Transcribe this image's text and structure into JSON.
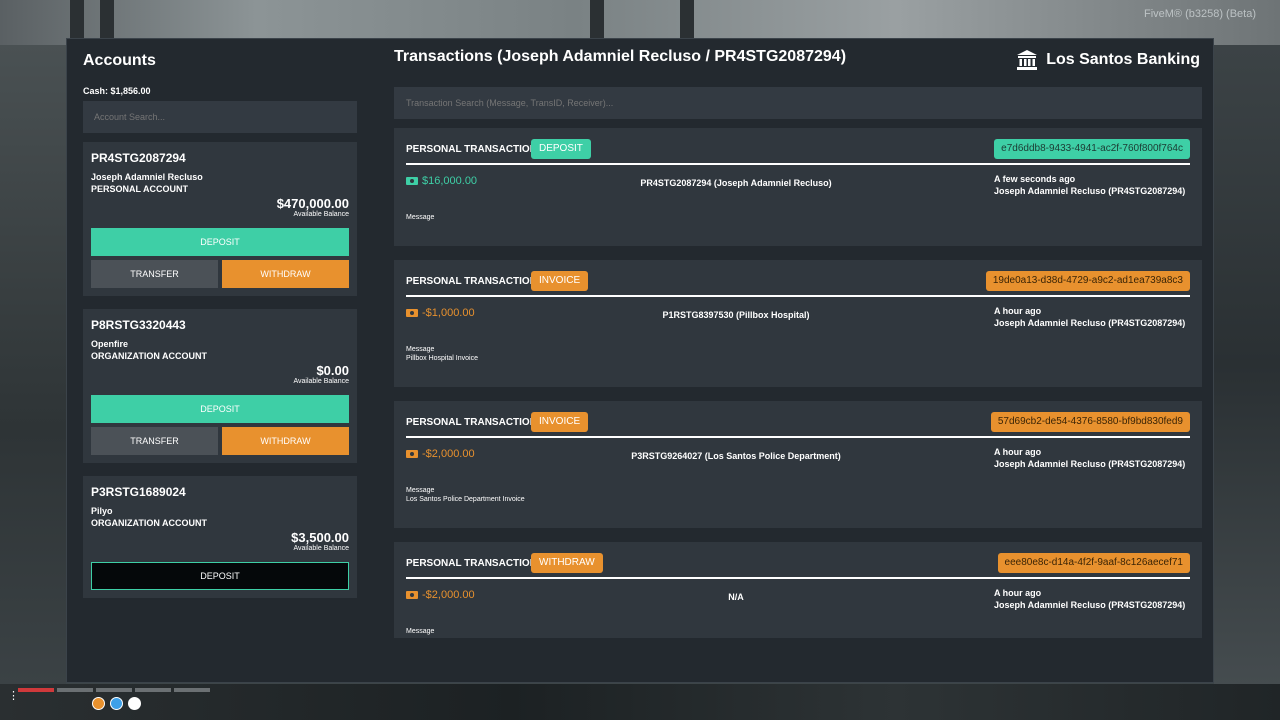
{
  "overlay": {
    "version": "FiveM® (b3258) (Beta)"
  },
  "accounts": {
    "title": "Accounts",
    "cash": "Cash: $1,856.00",
    "search_placeholder": "Account Search...",
    "items": [
      {
        "id": "PR4STG2087294",
        "holder": "Joseph Adamniel Recluso",
        "type": "PERSONAL ACCOUNT",
        "balance": "$470,000.00",
        "balance_label": "Available Balance",
        "deposit": "DEPOSIT",
        "transfer": "TRANSFER",
        "withdraw": "WITHDRAW"
      },
      {
        "id": "P8RSTG3320443",
        "holder": "Openfire",
        "type": "ORGANIZATION ACCOUNT",
        "balance": "$0.00",
        "balance_label": "Available Balance",
        "deposit": "DEPOSIT",
        "transfer": "TRANSFER",
        "withdraw": "WITHDRAW"
      },
      {
        "id": "P3RSTG1689024",
        "holder": "Pilyo",
        "type": "ORGANIZATION ACCOUNT",
        "balance": "$3,500.00",
        "balance_label": "Available Balance",
        "deposit": "DEPOSIT"
      }
    ]
  },
  "transactions": {
    "title": "Transactions (Joseph Adamniel Recluso / PR4STG2087294)",
    "bank_name": "Los Santos Banking",
    "search_placeholder": "Transaction Search (Message, TransID, Receiver)...",
    "items": [
      {
        "type": "PERSONAL TRANSACTION",
        "badge": "DEPOSIT",
        "trans_id": "e7d6ddb8-9433-4941-ac2f-760f800f764c",
        "amount": "$16,000.00",
        "receiver": "PR4STG2087294 (Joseph Adamniel Recluso)",
        "time": "A few seconds ago",
        "by": "Joseph Adamniel Recluso (PR4STG2087294)",
        "message_label": "Message",
        "message": ""
      },
      {
        "type": "PERSONAL TRANSACTION",
        "badge": "INVOICE",
        "trans_id": "19de0a13-d38d-4729-a9c2-ad1ea739a8c3",
        "amount": "-$1,000.00",
        "receiver": "P1RSTG8397530 (Pillbox Hospital)",
        "time": "A hour ago",
        "by": "Joseph Adamniel Recluso (PR4STG2087294)",
        "message_label": "Message",
        "message": "Pillbox Hospital Invoice"
      },
      {
        "type": "PERSONAL TRANSACTION",
        "badge": "INVOICE",
        "trans_id": "57d69cb2-de54-4376-8580-bf9bd830fed9",
        "amount": "-$2,000.00",
        "receiver": "P3RSTG9264027 (Los Santos Police Department)",
        "time": "A hour ago",
        "by": "Joseph Adamniel Recluso (PR4STG2087294)",
        "message_label": "Message",
        "message": "Los Santos Police Department Invoice"
      },
      {
        "type": "PERSONAL TRANSACTION",
        "badge": "WITHDRAW",
        "trans_id": "eee80e8c-d14a-4f2f-9aaf-8c126aecef71",
        "amount": "-$2,000.00",
        "receiver": "N/A",
        "time": "A hour ago",
        "by": "Joseph Adamniel Recluso (PR4STG2087294)",
        "message_label": "Message",
        "message": ""
      }
    ]
  },
  "colors": {
    "deposit": "#3ecfa6",
    "withdraw": "#e8912e",
    "panel": "#23292f",
    "card": "#30373e"
  },
  "icons": {
    "bank": "bank-icon",
    "cash": "cash-icon"
  }
}
